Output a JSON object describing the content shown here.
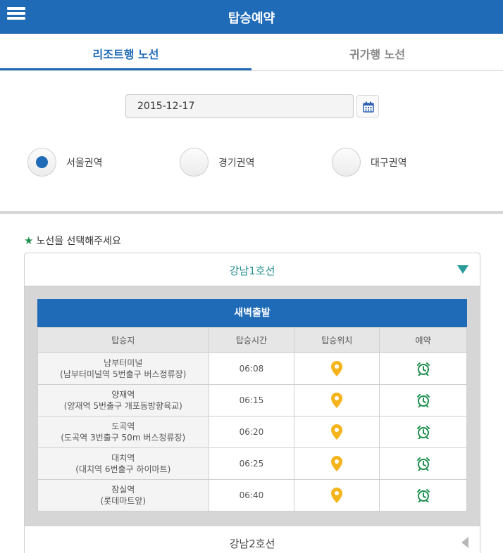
{
  "header": {
    "title": "탑승예약"
  },
  "tabs": [
    {
      "label": "리조트행 노선",
      "active": true
    },
    {
      "label": "귀가행 노선",
      "active": false
    }
  ],
  "date": {
    "value": "2015-12-17"
  },
  "regions": [
    {
      "label": "서울권역",
      "checked": true
    },
    {
      "label": "경기권역",
      "checked": false
    },
    {
      "label": "대구권역",
      "checked": false
    }
  ],
  "route_hint": "노선을 선택해주세요",
  "routes": [
    {
      "name": "강남1호선",
      "expanded": true
    },
    {
      "name": "강남2호선",
      "expanded": false
    }
  ],
  "schedule": {
    "title": "새벽출발",
    "columns": [
      "탑승지",
      "탑승시간",
      "탑승위치",
      "예약"
    ],
    "rows": [
      {
        "stop": "남부터미널",
        "detail": "(남부터미널역 5번출구 버스정류장)",
        "time": "06:08"
      },
      {
        "stop": "양재역",
        "detail": "(양재역 5번출구 개포동방향육교)",
        "time": "06:15"
      },
      {
        "stop": "도곡역",
        "detail": "(도곡역 3번출구 50m 버스정류장)",
        "time": "06:20"
      },
      {
        "stop": "대치역",
        "detail": "(대치역 6번출구 하이마트)",
        "time": "06:25"
      },
      {
        "stop": "잠실역",
        "detail": "(롯데마트앞)",
        "time": "06:40"
      }
    ]
  },
  "colors": {
    "primary": "#1f6bb8",
    "accent": "#1e8f4e",
    "pin": "#f5b31c"
  }
}
